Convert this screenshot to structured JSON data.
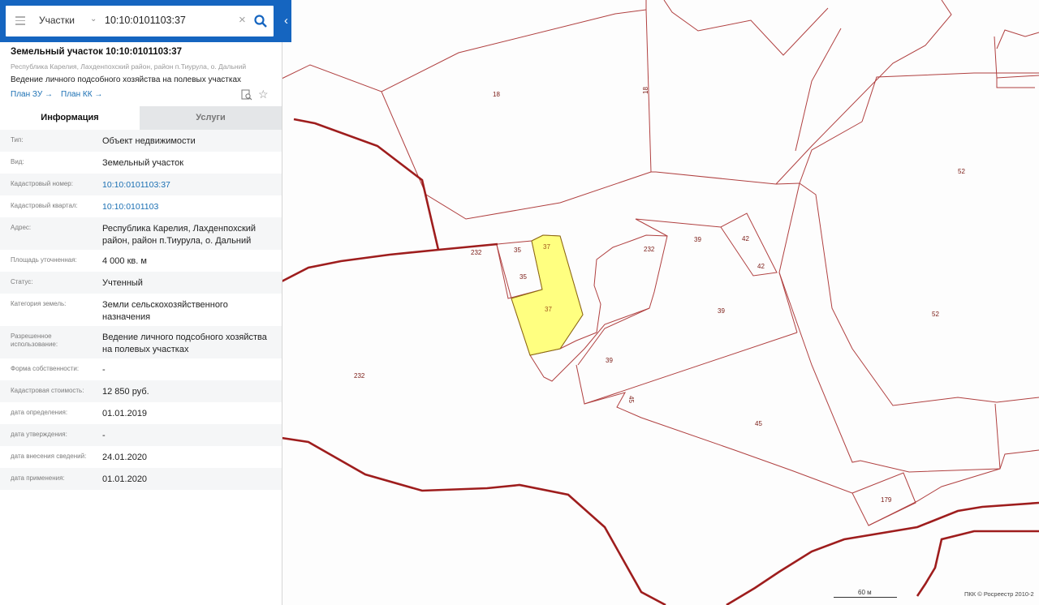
{
  "search": {
    "type_label": "Участки",
    "value": "10:10:0101103:37"
  },
  "parcel": {
    "title": "Земельный участок 10:10:0101103:37",
    "address_line": "Республика Карелия, Лахденпохский район, район п.Тиурула, о. Дальний",
    "usage_line": "Ведение личного подсобного хозяйства на полевых участках",
    "links": [
      "План ЗУ →",
      "План КК →"
    ]
  },
  "tabs": [
    "Информация",
    "Услуги"
  ],
  "info": [
    {
      "key": "Тип:",
      "value": "Объект недвижимости"
    },
    {
      "key": "Вид:",
      "value": "Земельный участок"
    },
    {
      "key": "Кадастровый номер:",
      "value": "10:10:0101103:37"
    },
    {
      "key": "Кадастровый квартал:",
      "value": "10:10:0101103"
    },
    {
      "key": "Адрес:",
      "value": "Республика Карелия, Лахденпохский район, район п.Тиурула, о. Дальний"
    },
    {
      "key": "Площадь уточненная:",
      "value": "4 000 кв. м"
    },
    {
      "key": "Статус:",
      "value": "Учтенный"
    },
    {
      "key": "Категория земель:",
      "value": "Земли сельскохозяйственного назначения"
    },
    {
      "key": "Разрешенное использование:",
      "value": "Ведение личного подсобного хозяйства на полевых участках"
    },
    {
      "key": "Форма собственности:",
      "value": "-"
    },
    {
      "key": "Кадастровая стоимость:",
      "value": "12 850 руб."
    },
    {
      "key": "дата определения:",
      "value": "01.01.2019"
    },
    {
      "key": "дата утверждения:",
      "value": "-"
    },
    {
      "key": "дата внесения сведений:",
      "value": "24.01.2020"
    },
    {
      "key": "дата применения:",
      "value": "01.01.2020"
    }
  ],
  "map": {
    "parcel_labels": [
      "18",
      "18",
      "52",
      "52",
      "232",
      "232",
      "232",
      "35",
      "35",
      "37",
      "37",
      "39",
      "39",
      "39",
      "42",
      "42",
      "45",
      "45",
      "179"
    ],
    "scale": "60 м",
    "copyright": "ПКК © Росреестр 2010-2"
  },
  "colors": {
    "header": "#1565c0",
    "selected_parcel": "#ffff7a",
    "boundary": "#a52a2a"
  }
}
